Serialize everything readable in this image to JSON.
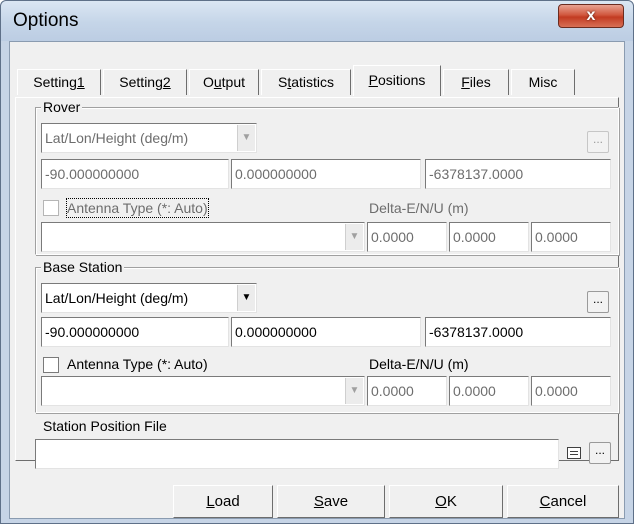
{
  "window": {
    "title": "Options",
    "close_label": "x"
  },
  "tabs": [
    {
      "pre": "Setting",
      "ul": "1",
      "post": ""
    },
    {
      "pre": "Setting",
      "ul": "2",
      "post": ""
    },
    {
      "pre": "O",
      "ul": "u",
      "post": "tput"
    },
    {
      "pre": "S",
      "ul": "t",
      "post": "atistics"
    },
    {
      "pre": "",
      "ul": "P",
      "post": "ositions"
    },
    {
      "pre": "",
      "ul": "F",
      "post": "iles"
    },
    {
      "pre": "Misc",
      "ul": "",
      "post": ""
    }
  ],
  "rover": {
    "label": "Rover",
    "format": "Lat/Lon/Height (deg/m)",
    "pos1": "-90.000000000",
    "pos2": "0.000000000",
    "pos3": "-6378137.0000",
    "browse": "...",
    "antenna_label": "Antenna Type (*: Auto)",
    "antenna_value": "",
    "delta_label": "Delta-E/N/U (m)",
    "de": "0.0000",
    "dn": "0.0000",
    "du": "0.0000"
  },
  "base": {
    "label": "Base Station",
    "format": "Lat/Lon/Height (deg/m)",
    "pos1": "-90.000000000",
    "pos2": "0.000000000",
    "pos3": "-6378137.0000",
    "browse": "...",
    "antenna_label": "Antenna Type (*: Auto)",
    "antenna_value": "",
    "delta_label": "Delta-E/N/U (m)",
    "de": "0.0000",
    "dn": "0.0000",
    "du": "0.0000"
  },
  "station_file": {
    "label": "Station Position File",
    "value": "",
    "browse": "..."
  },
  "buttons": {
    "load": {
      "ul": "L",
      "rest": "oad"
    },
    "save": {
      "ul": "S",
      "rest": "ave"
    },
    "ok": {
      "ul": "O",
      "rest": "K"
    },
    "cancel": {
      "ul": "C",
      "rest": "ancel"
    }
  }
}
